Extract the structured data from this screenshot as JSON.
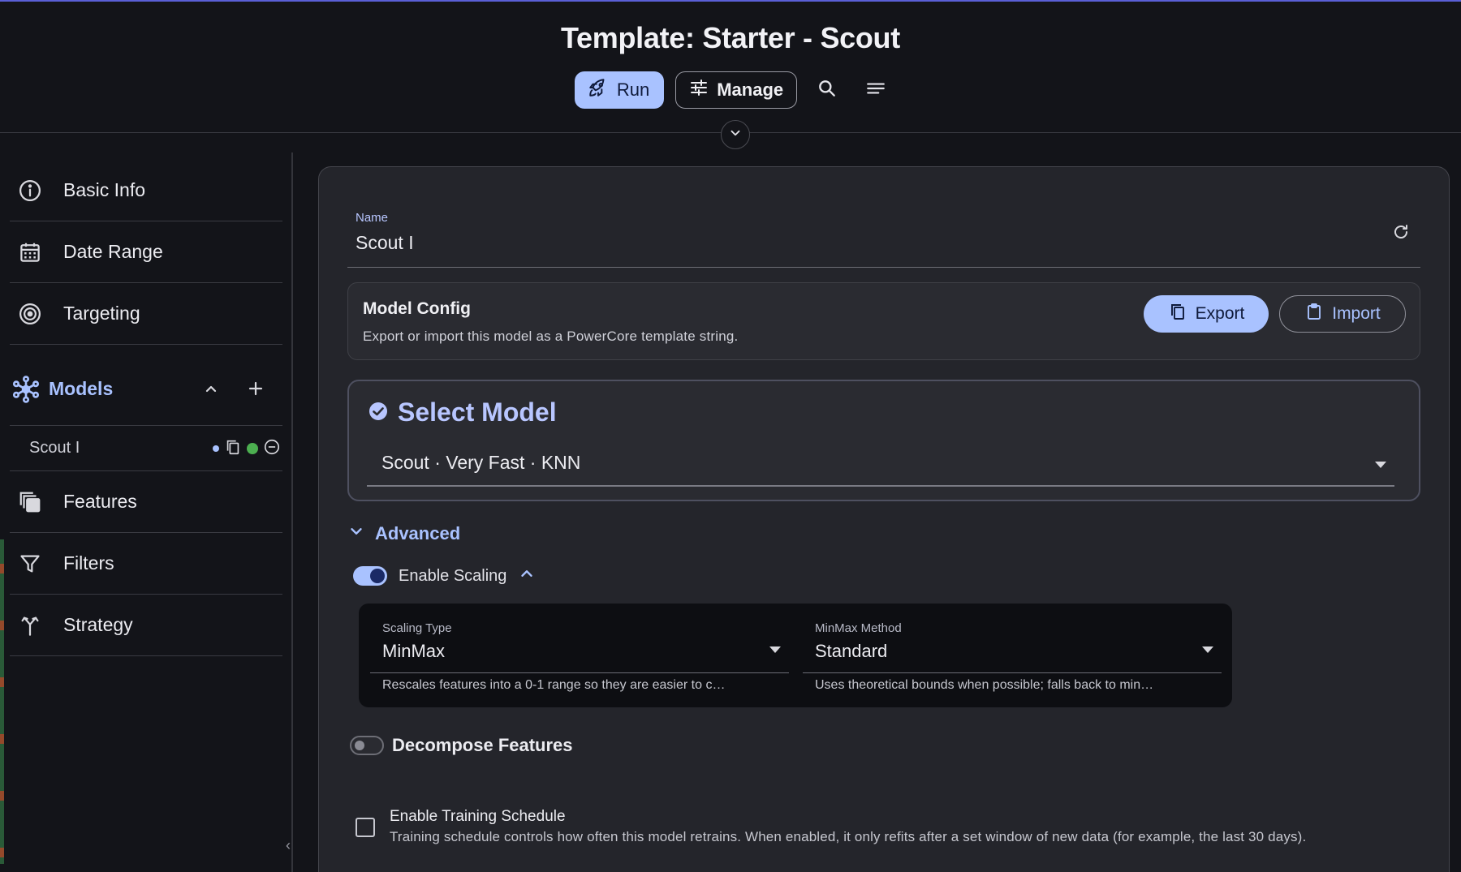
{
  "header": {
    "title": "Template: Starter - Scout",
    "run_label": "Run",
    "manage_label": "Manage",
    "icons": [
      "rocket-icon",
      "sliders-icon",
      "search-icon",
      "menu-icon",
      "chevron-down-icon"
    ]
  },
  "sidebar": {
    "items_top": [
      {
        "label": "Basic Info",
        "icon": "info-icon"
      },
      {
        "label": "Date Range",
        "icon": "calendar-icon"
      },
      {
        "label": "Targeting",
        "icon": "target-icon"
      }
    ],
    "models": {
      "label": "Models",
      "sub_items": [
        {
          "label": "Scout I",
          "status": "active"
        }
      ]
    },
    "items_bottom": [
      {
        "label": "Features",
        "icon": "layers-icon"
      },
      {
        "label": "Filters",
        "icon": "filter-icon"
      },
      {
        "label": "Strategy",
        "icon": "merge-icon"
      }
    ]
  },
  "main": {
    "name_field": {
      "label": "Name",
      "value": "Scout I"
    },
    "model_config": {
      "title": "Model Config",
      "subtitle": "Export or import this model as a PowerCore template string.",
      "export_label": "Export",
      "import_label": "Import"
    },
    "select_model": {
      "title": "Select Model",
      "value": "Scout · Very Fast · KNN"
    },
    "advanced": {
      "label": "Advanced",
      "enable_scaling_label": "Enable Scaling",
      "enable_scaling_on": true,
      "scaling_type": {
        "label": "Scaling Type",
        "value": "MinMax",
        "helper": "Rescales features into a 0-1 range so they are easier to c…"
      },
      "minmax_method": {
        "label": "MinMax Method",
        "value": "Standard",
        "helper": "Uses theoretical bounds when possible; falls back to min…"
      },
      "decompose_label": "Decompose Features",
      "decompose_on": false,
      "training_schedule": {
        "label": "Enable Training Schedule",
        "checked": false,
        "description": "Training schedule controls how often this model retrains. When enabled, it only refits after a set window of new data (for example, the last 30 days)."
      }
    }
  },
  "colors": {
    "accent": "#a9c2ff",
    "background": "#131419",
    "panel": "#24252b",
    "status_green": "#4caf50"
  }
}
